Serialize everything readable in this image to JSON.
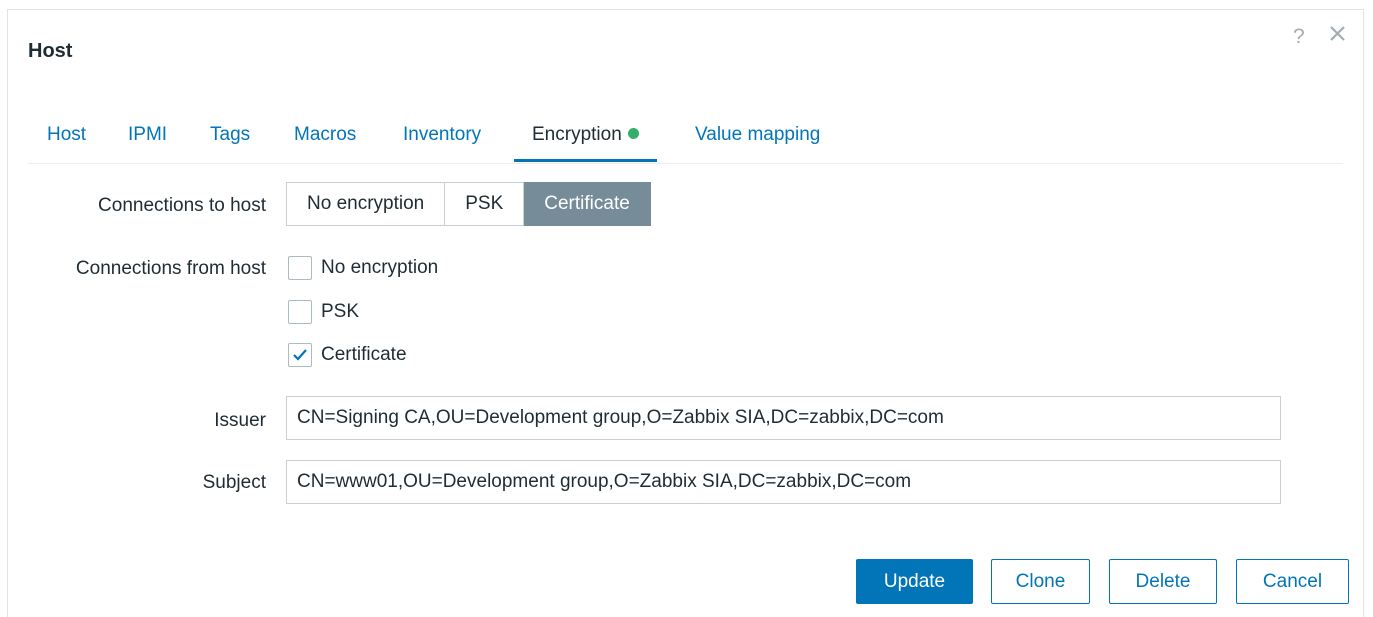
{
  "dialog": {
    "title": "Host",
    "help_glyph": "?",
    "close_icon": "close-icon"
  },
  "tabs": [
    {
      "label": "Host",
      "active": false
    },
    {
      "label": "IPMI",
      "active": false
    },
    {
      "label": "Tags",
      "active": false
    },
    {
      "label": "Macros",
      "active": false
    },
    {
      "label": "Inventory",
      "active": false
    },
    {
      "label": "Encryption",
      "active": true,
      "indicator": "green-dot"
    },
    {
      "label": "Value mapping",
      "active": false
    }
  ],
  "form": {
    "connections_to_host": {
      "label": "Connections to host",
      "options": [
        "No encryption",
        "PSK",
        "Certificate"
      ],
      "selected": "Certificate"
    },
    "connections_from_host": {
      "label": "Connections from host",
      "options": [
        {
          "label": "No encryption",
          "checked": false
        },
        {
          "label": "PSK",
          "checked": false
        },
        {
          "label": "Certificate",
          "checked": true
        }
      ]
    },
    "issuer": {
      "label": "Issuer",
      "value": "CN=Signing CA,OU=Development group,O=Zabbix SIA,DC=zabbix,DC=com"
    },
    "subject": {
      "label": "Subject",
      "value": "CN=www01,OU=Development group,O=Zabbix SIA,DC=zabbix,DC=com"
    }
  },
  "buttons": {
    "update": "Update",
    "clone": "Clone",
    "delete": "Delete",
    "cancel": "Cancel"
  },
  "colors": {
    "accent": "#0275b8",
    "selected_segment": "#768d99",
    "indicator_green": "#34af67"
  }
}
